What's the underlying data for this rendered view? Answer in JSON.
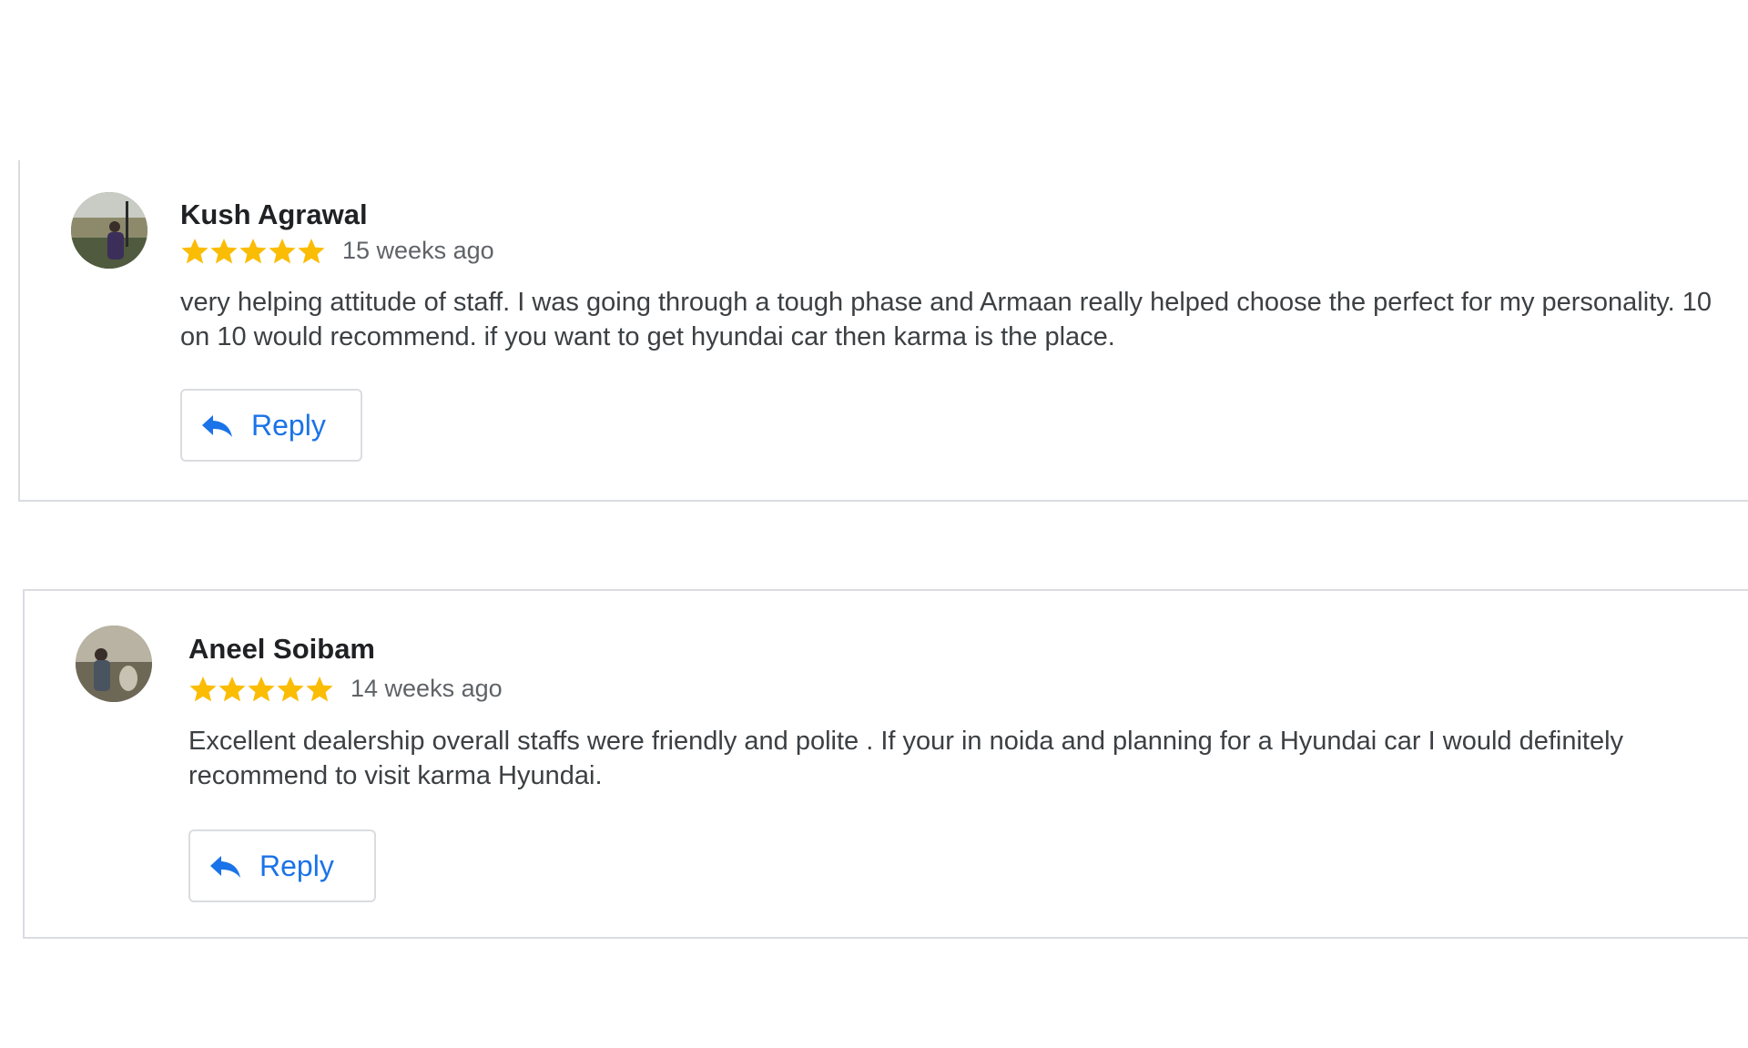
{
  "colors": {
    "star": "#fbbc04",
    "reply_text": "#1a73e8",
    "border": "#dadce0",
    "timestamp": "#5f6368"
  },
  "reviews": [
    {
      "name": "Kush Agrawal",
      "rating": 5,
      "rating_max": 5,
      "time": "15 weeks ago",
      "text": "very helping attitude of staff. I was going through a tough phase and Armaan really helped choose the perfect for my personality. 10 on 10 would recommend. if you want to get hyundai car then karma is the place.",
      "reply_label": "Reply",
      "reply_icon": "reply-arrow-icon",
      "star_icon": "star-icon",
      "avatar": "profile-photo"
    },
    {
      "name": "Aneel Soibam",
      "rating": 5,
      "rating_max": 5,
      "time": "14 weeks ago",
      "text": "Excellent dealership overall staffs were friendly and polite . If your in noida and planning for a Hyundai car I would definitely recommend to visit karma Hyundai.",
      "reply_label": "Reply",
      "reply_icon": "reply-arrow-icon",
      "star_icon": "star-icon",
      "avatar": "profile-photo"
    }
  ]
}
